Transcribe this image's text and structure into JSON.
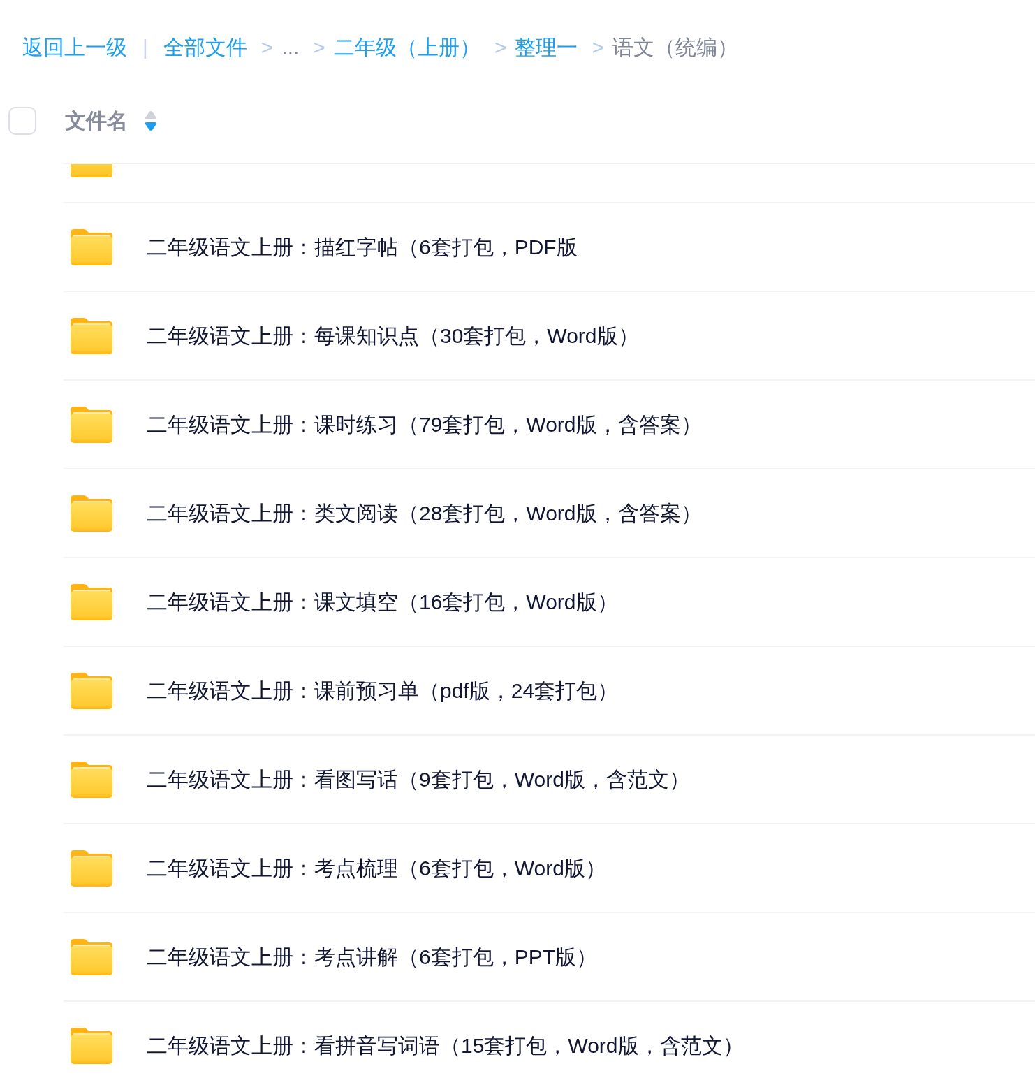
{
  "breadcrumb": {
    "back": "返回上一级",
    "divider": "|",
    "items": [
      {
        "label": "全部文件",
        "kind": "link"
      },
      {
        "label": "...",
        "kind": "ellipsis",
        "separator": ">"
      },
      {
        "label": "二年级（上册）",
        "kind": "link",
        "separator": ">"
      },
      {
        "label": "整理一",
        "kind": "link",
        "separator": ">"
      },
      {
        "label": "语文（统编）",
        "kind": "current",
        "separator": ">"
      }
    ]
  },
  "header": {
    "checked": false,
    "column": "文件名",
    "sort_up": false,
    "sort_down": true
  },
  "clipped_row": {
    "kind": "folder"
  },
  "rows": [
    {
      "kind": "folder",
      "name": "二年级语文上册：描红字帖（6套打包，PDF版"
    },
    {
      "kind": "folder",
      "name": "二年级语文上册：每课知识点（30套打包，Word版）"
    },
    {
      "kind": "folder",
      "name": "二年级语文上册：课时练习（79套打包，Word版，含答案）"
    },
    {
      "kind": "folder",
      "name": "二年级语文上册：类文阅读（28套打包，Word版，含答案）"
    },
    {
      "kind": "folder",
      "name": "二年级语文上册：课文填空（16套打包，Word版）"
    },
    {
      "kind": "folder",
      "name": "二年级语文上册：课前预习单（pdf版，24套打包）"
    },
    {
      "kind": "folder",
      "name": "二年级语文上册：看图写话（9套打包，Word版，含范文）"
    },
    {
      "kind": "folder",
      "name": "二年级语文上册：考点梳理（6套打包，Word版）"
    },
    {
      "kind": "folder",
      "name": "二年级语文上册：考点讲解（6套打包，PPT版）"
    },
    {
      "kind": "folder",
      "name": "二年级语文上册：看拼音写词语（15套打包，Word版，含范文）"
    }
  ]
}
